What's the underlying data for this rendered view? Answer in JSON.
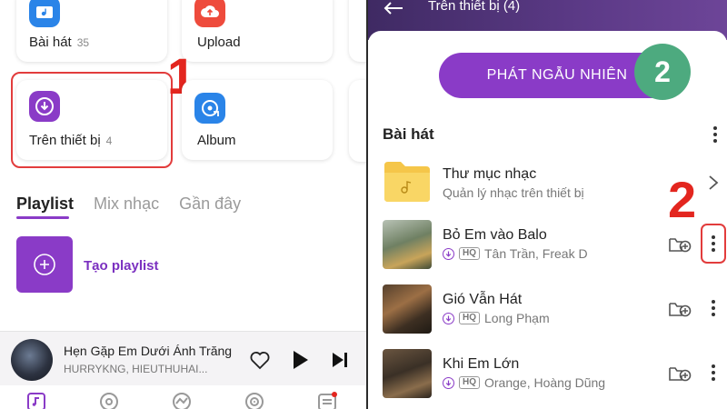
{
  "left": {
    "tiles": [
      {
        "label": "Bài hát",
        "count": "35",
        "icon": "music-folder-icon",
        "color": "#2a84e8"
      },
      {
        "label": "Upload",
        "count": "",
        "icon": "cloud-upload-icon",
        "color": "#ee4b3c"
      },
      {
        "label": "Trên thiết bị",
        "count": "4",
        "icon": "download-circle-icon",
        "color": "#8a3bc7"
      },
      {
        "label": "Album",
        "count": "",
        "icon": "album-icon",
        "color": "#2a84e8"
      }
    ],
    "step_number": "1",
    "tabs": [
      "Playlist",
      "Mix nhạc",
      "Gần đây"
    ],
    "create_playlist_label": "Tạo playlist",
    "mini_player": {
      "title": "Hẹn Gặp Em Dưới Ánh Trăng",
      "artist": "HURRYKNG, HIEUTHUHAI..."
    }
  },
  "right": {
    "header_title": "Trên thiết bị (4)",
    "shuffle_label": "PHÁT NGẪU NHIÊN",
    "badge_number": "2",
    "section_title": "Bài hát",
    "step_number": "2",
    "folder": {
      "title": "Thư mục nhạc",
      "subtitle": "Quản lý nhạc trên thiết bị"
    },
    "songs": [
      {
        "title": "Bỏ Em vào Balo",
        "artist": "Tân Trần, Freak D",
        "hq": "HQ"
      },
      {
        "title": "Gió Vẫn Hát",
        "artist": "Long Phạm",
        "hq": "HQ"
      },
      {
        "title": "Khi Em Lớn",
        "artist": "Orange, Hoàng Dũng",
        "hq": "HQ"
      }
    ]
  },
  "colors": {
    "accent": "#8a3bc7",
    "annotation_red": "#e3261f",
    "badge_green": "#4daa7f"
  }
}
